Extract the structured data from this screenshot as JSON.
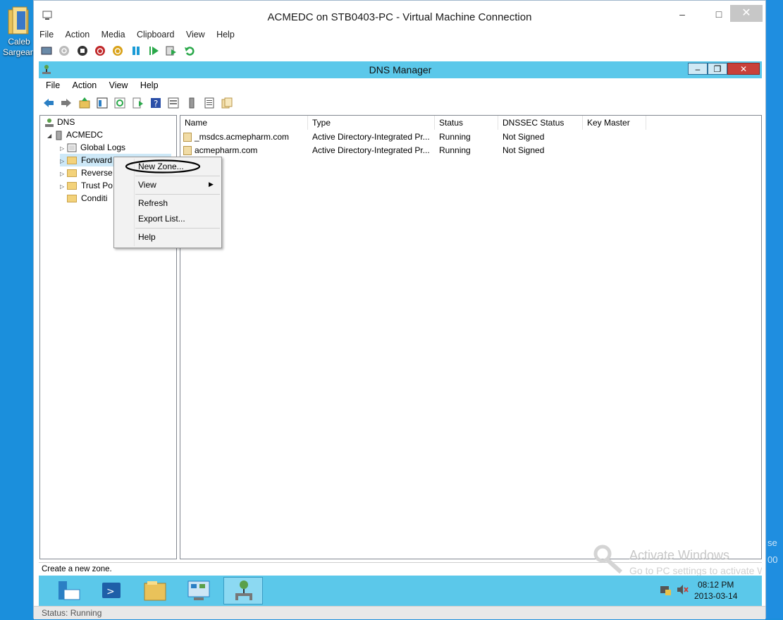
{
  "desktop": {
    "icon_label": "Caleb Sargeant",
    "right_text_1": "se",
    "right_text_2": "00"
  },
  "vm": {
    "title": "ACMEDC on STB0403-PC - Virtual Machine Connection",
    "menu": [
      "File",
      "Action",
      "Media",
      "Clipboard",
      "View",
      "Help"
    ],
    "status": "Status: Running"
  },
  "dns": {
    "title": "DNS Manager",
    "menu": [
      "File",
      "Action",
      "View",
      "Help"
    ],
    "tree": {
      "root": "DNS",
      "server": "ACMEDC",
      "items": [
        "Global Logs",
        "Forward",
        "Reverse",
        "Trust Po",
        "Conditi"
      ]
    },
    "columns": [
      "Name",
      "Type",
      "Status",
      "DNSSEC Status",
      "Key Master"
    ],
    "rows": [
      {
        "name": "_msdcs.acmepharm.com",
        "type": "Active Directory-Integrated Pr...",
        "status": "Running",
        "dnssec": "Not Signed",
        "key_master": ""
      },
      {
        "name": "acmepharm.com",
        "type": "Active Directory-Integrated Pr...",
        "status": "Running",
        "dnssec": "Not Signed",
        "key_master": ""
      }
    ],
    "context_menu": {
      "new_zone": "New Zone...",
      "view": "View",
      "refresh": "Refresh",
      "export": "Export List...",
      "help": "Help"
    },
    "status_bar": "Create a new zone.",
    "watermark_1": "Activate Windows",
    "watermark_2": "Go to PC settings to activate Win",
    "clock_time": "08:12 PM",
    "clock_date": "2013-03-14"
  },
  "colors": {
    "title_bar": "#5bc8ea",
    "desktop": "#1b8fdc",
    "close": "#c7c7c7",
    "dns_close": "#c9413a"
  }
}
